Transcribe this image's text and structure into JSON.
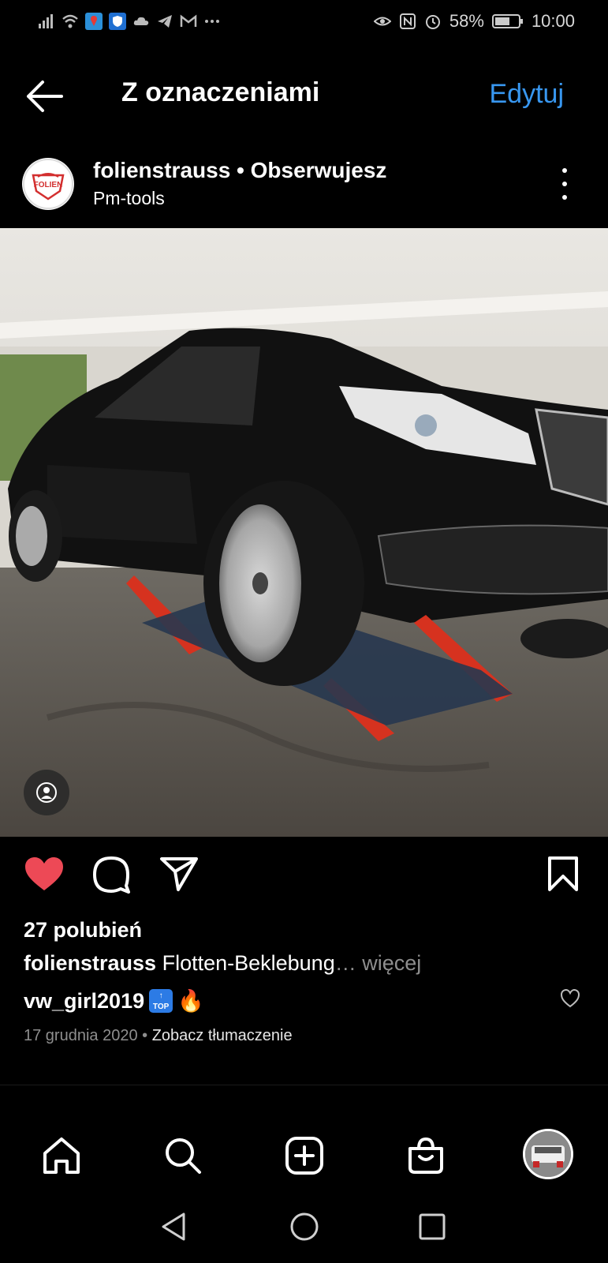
{
  "status_bar": {
    "battery": "58%",
    "time": "10:00",
    "left_icons": [
      "signal-icon",
      "wifi-icon",
      "maps-icon",
      "shield-icon",
      "cloud-icon",
      "telegram-icon",
      "gmail-icon",
      "more-dots-icon"
    ],
    "right_icons": [
      "eye-icon",
      "nfc-icon",
      "alarm-icon",
      "battery-icon"
    ]
  },
  "header": {
    "title": "Z oznaczeniami",
    "edit_label": "Edytuj"
  },
  "post": {
    "username": "folienstrauss",
    "separator": " • ",
    "follow_status": "Obserwujesz",
    "location": "Pm-tools",
    "avatar_text": "FOLIEN",
    "likes": "27 polubień",
    "caption_user": "folienstrauss",
    "caption_text": "Flotten-Beklebung",
    "caption_more": "… więcej",
    "comment_user": "vw_girl2019",
    "comment_emoji_top": "TOP",
    "comment_emoji_fire": "🔥",
    "date": "17 grudnia 2020",
    "meta_separator": " • ",
    "translate": "Zobacz tłumaczenie"
  },
  "colors": {
    "accent_blue": "#3897f0",
    "like_red": "#ed4956",
    "muted_gray": "#8e8e8e",
    "background": "#000000"
  },
  "nav": [
    "home-icon",
    "search-icon",
    "create-post-icon",
    "shop-icon",
    "profile-avatar"
  ],
  "system_nav": [
    "back-triangle-icon",
    "home-circle-icon",
    "recents-square-icon"
  ]
}
